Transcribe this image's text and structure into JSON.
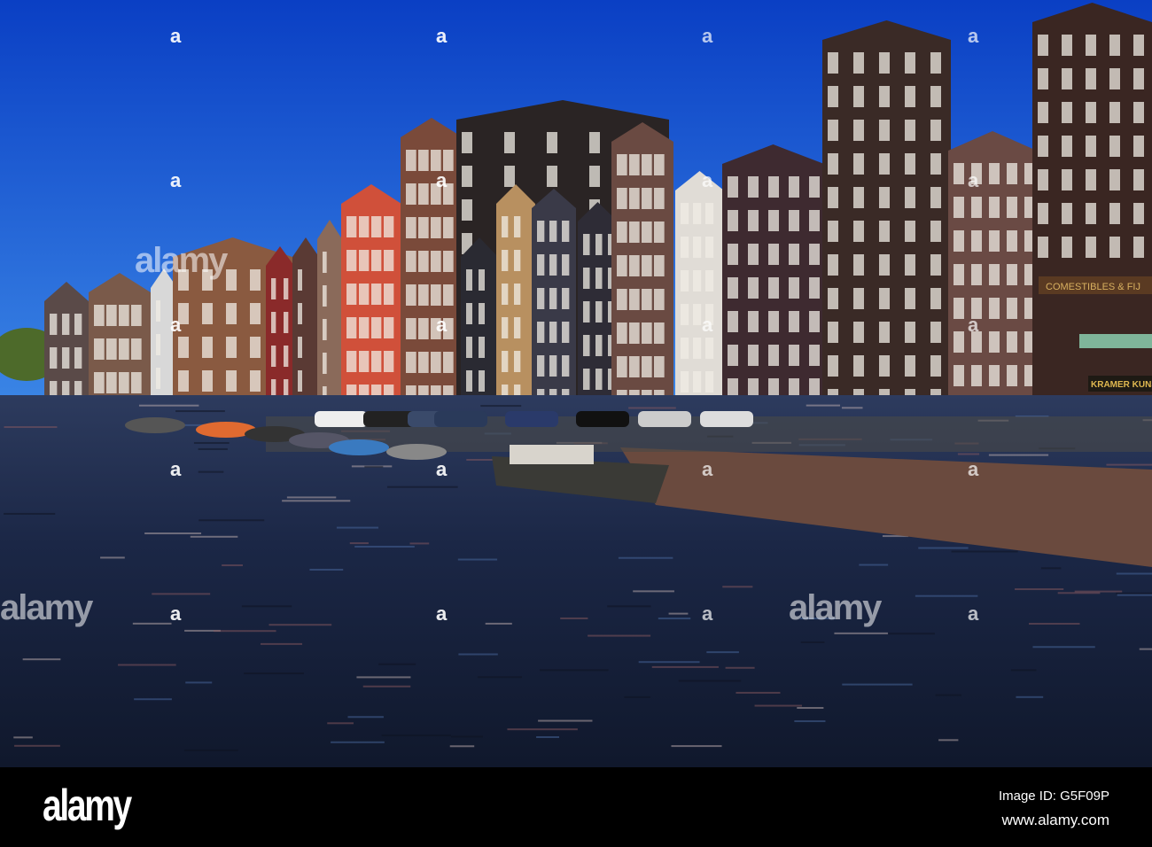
{
  "photo": {
    "subject": "Canal with gabled houses, moored boats and parked cars",
    "shop_sign": "COMESTIBLES & FIJ",
    "shop_window": "KRAMER KUNST"
  },
  "watermark": {
    "text": "alamy",
    "mark": "a"
  },
  "footer": {
    "logo": "alamy",
    "image_id": "Image ID: G5F09P",
    "website": "www.alamy.com"
  },
  "colors": {
    "sky_top": "#0a3fc4",
    "sky_bottom": "#2a78e0",
    "water": "#1a2a48",
    "footer": "#000000"
  }
}
